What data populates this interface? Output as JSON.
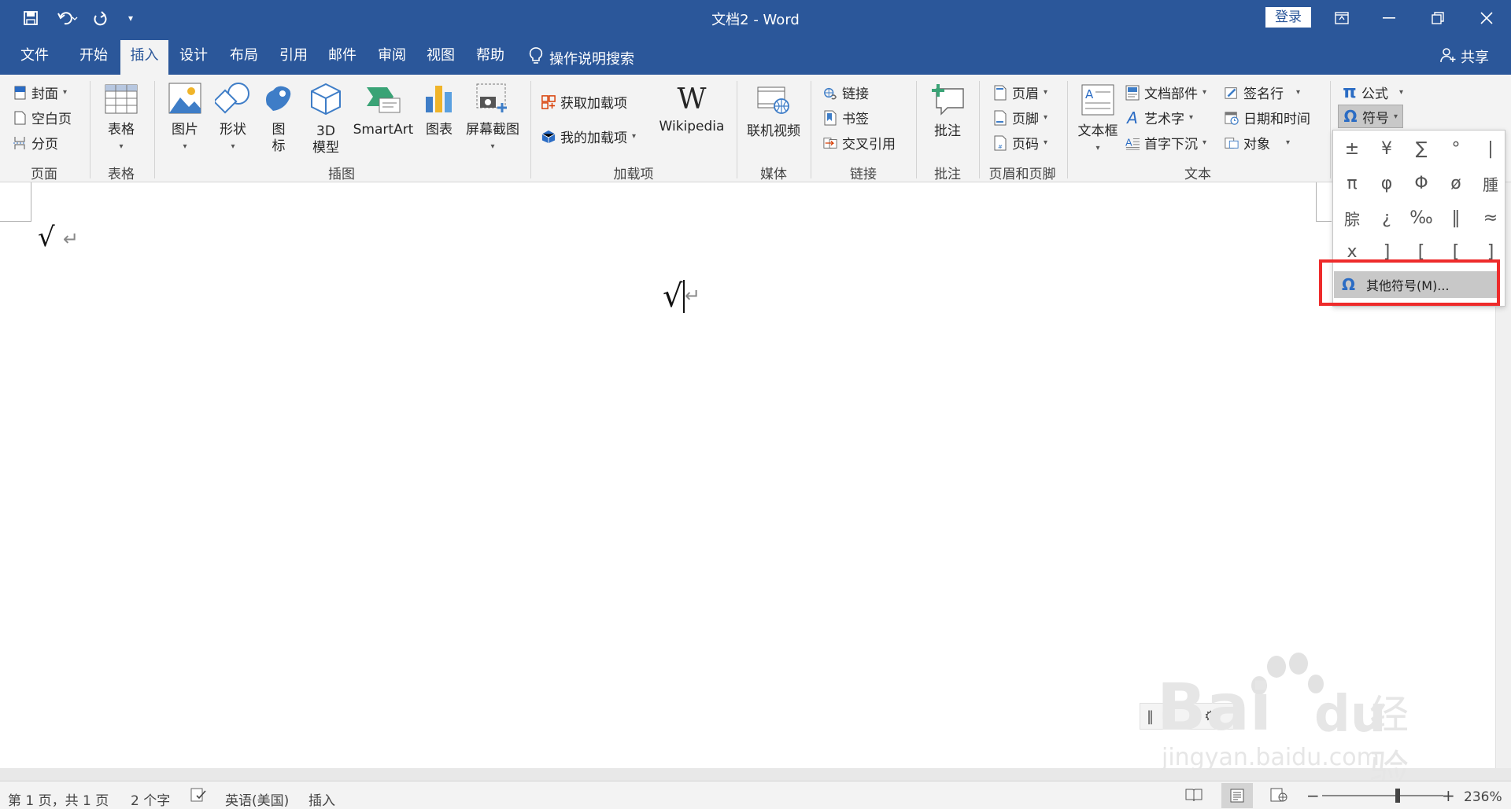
{
  "window": {
    "title": "文档2  -  Word",
    "login_label": "登录",
    "accent_color": "#2b579a"
  },
  "quick_access": {
    "save_icon": "save-icon",
    "undo_icon": "undo-icon",
    "redo_icon": "redo-icon",
    "customize_icon": "customize-icon"
  },
  "tabs": [
    {
      "label": "文件"
    },
    {
      "label": "开始"
    },
    {
      "label": "插入",
      "active": true
    },
    {
      "label": "设计"
    },
    {
      "label": "布局"
    },
    {
      "label": "引用"
    },
    {
      "label": "邮件"
    },
    {
      "label": "审阅"
    },
    {
      "label": "视图"
    },
    {
      "label": "帮助"
    }
  ],
  "tell_me": "操作说明搜索",
  "share": "共享",
  "ribbon": {
    "pages": {
      "label": "页面",
      "cover": "封面",
      "blank": "空白页",
      "break": "分页"
    },
    "tables": {
      "label": "表格",
      "table": "表格"
    },
    "illustrations": {
      "label": "插图",
      "picture": "图片",
      "shapes": "形状",
      "icons_line1": "图",
      "icons_line2": "标",
      "model_line1": "3D",
      "model_line2": "模型",
      "smartart": "SmartArt",
      "chart": "图表",
      "screenshot": "屏幕截图"
    },
    "addins": {
      "label": "加载项",
      "get": "获取加载项",
      "my": "我的加载项",
      "wikipedia": "Wikipedia"
    },
    "media": {
      "label": "媒体",
      "online_video": "联机视频"
    },
    "links": {
      "label": "链接",
      "link": "链接",
      "bookmark": "书签",
      "cross_ref": "交叉引用"
    },
    "comments": {
      "label": "批注",
      "comment": "批注"
    },
    "header_footer": {
      "label": "页眉和页脚",
      "header": "页眉",
      "footer": "页脚",
      "page_number": "页码"
    },
    "text": {
      "label": "文本",
      "textbox": "文本框",
      "quick_parts": "文档部件",
      "wordart": "艺术字",
      "dropcap": "首字下沉",
      "signature": "签名行",
      "datetime": "日期和时间",
      "object": "对象"
    },
    "symbols": {
      "equation": "公式",
      "symbol": "符号"
    }
  },
  "symbol_panel": {
    "symbols": [
      "±",
      "¥",
      "∑",
      "°",
      "|",
      "π",
      "φ",
      "Φ",
      "ø",
      "腫",
      "腙",
      "¿",
      "‰",
      "‖",
      "≈",
      "x",
      "]",
      "[",
      "[",
      "]"
    ],
    "more_label": "其他符号(M)..."
  },
  "document": {
    "line1": "√",
    "line2": "√",
    "pilcrow": "↵"
  },
  "status": {
    "page": "第 1 页，共 1 页",
    "words": "2 个字",
    "language": "英语(美国)",
    "mode": "插入",
    "zoom": "236%",
    "zoom_minus": "−",
    "zoom_plus": "+"
  },
  "watermark": {
    "brand": "Bai",
    "brand2": "du",
    "cn": "经验",
    "url": "jingyan.baidu.com"
  }
}
